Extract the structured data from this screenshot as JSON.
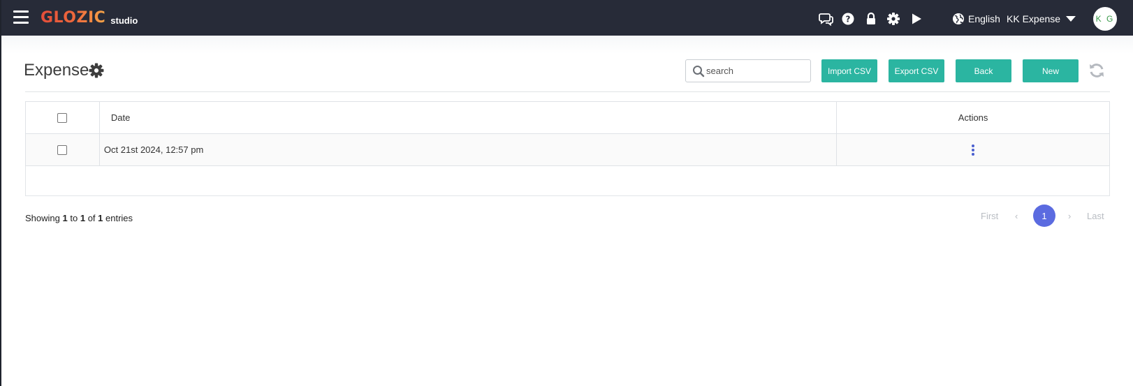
{
  "topbar": {
    "logo_main": "GLOZIC",
    "logo_sub": "studio",
    "language": "English",
    "app_name": "KK Expense",
    "avatar_initials": "K G",
    "icons": [
      "menu-icon",
      "chat-icon",
      "help-icon",
      "lock-icon",
      "gear-icon",
      "play-icon",
      "globe-icon",
      "caret-down-icon"
    ]
  },
  "page": {
    "title": "Expense",
    "search_placeholder": "search",
    "buttons": {
      "import": "Import CSV",
      "export": "Export CSV",
      "back": "Back",
      "new": "New"
    }
  },
  "table": {
    "headers": {
      "date": "Date",
      "actions": "Actions"
    },
    "rows": [
      {
        "date": "Oct 21st 2024, 12:57 pm"
      }
    ]
  },
  "footer": {
    "showing_prefix": "Showing",
    "from": "1",
    "to_word": "to",
    "to": "1",
    "of_word": "of",
    "total": "1",
    "entries_word": "entries"
  },
  "pagination": {
    "first": "First",
    "prev": "‹",
    "current": "1",
    "next": "›",
    "last": "Last"
  },
  "colors": {
    "topbar": "#272b38",
    "accent_button": "#2bb5a1",
    "pager_active": "#5b6be0",
    "kebab": "#4a5fcf"
  }
}
